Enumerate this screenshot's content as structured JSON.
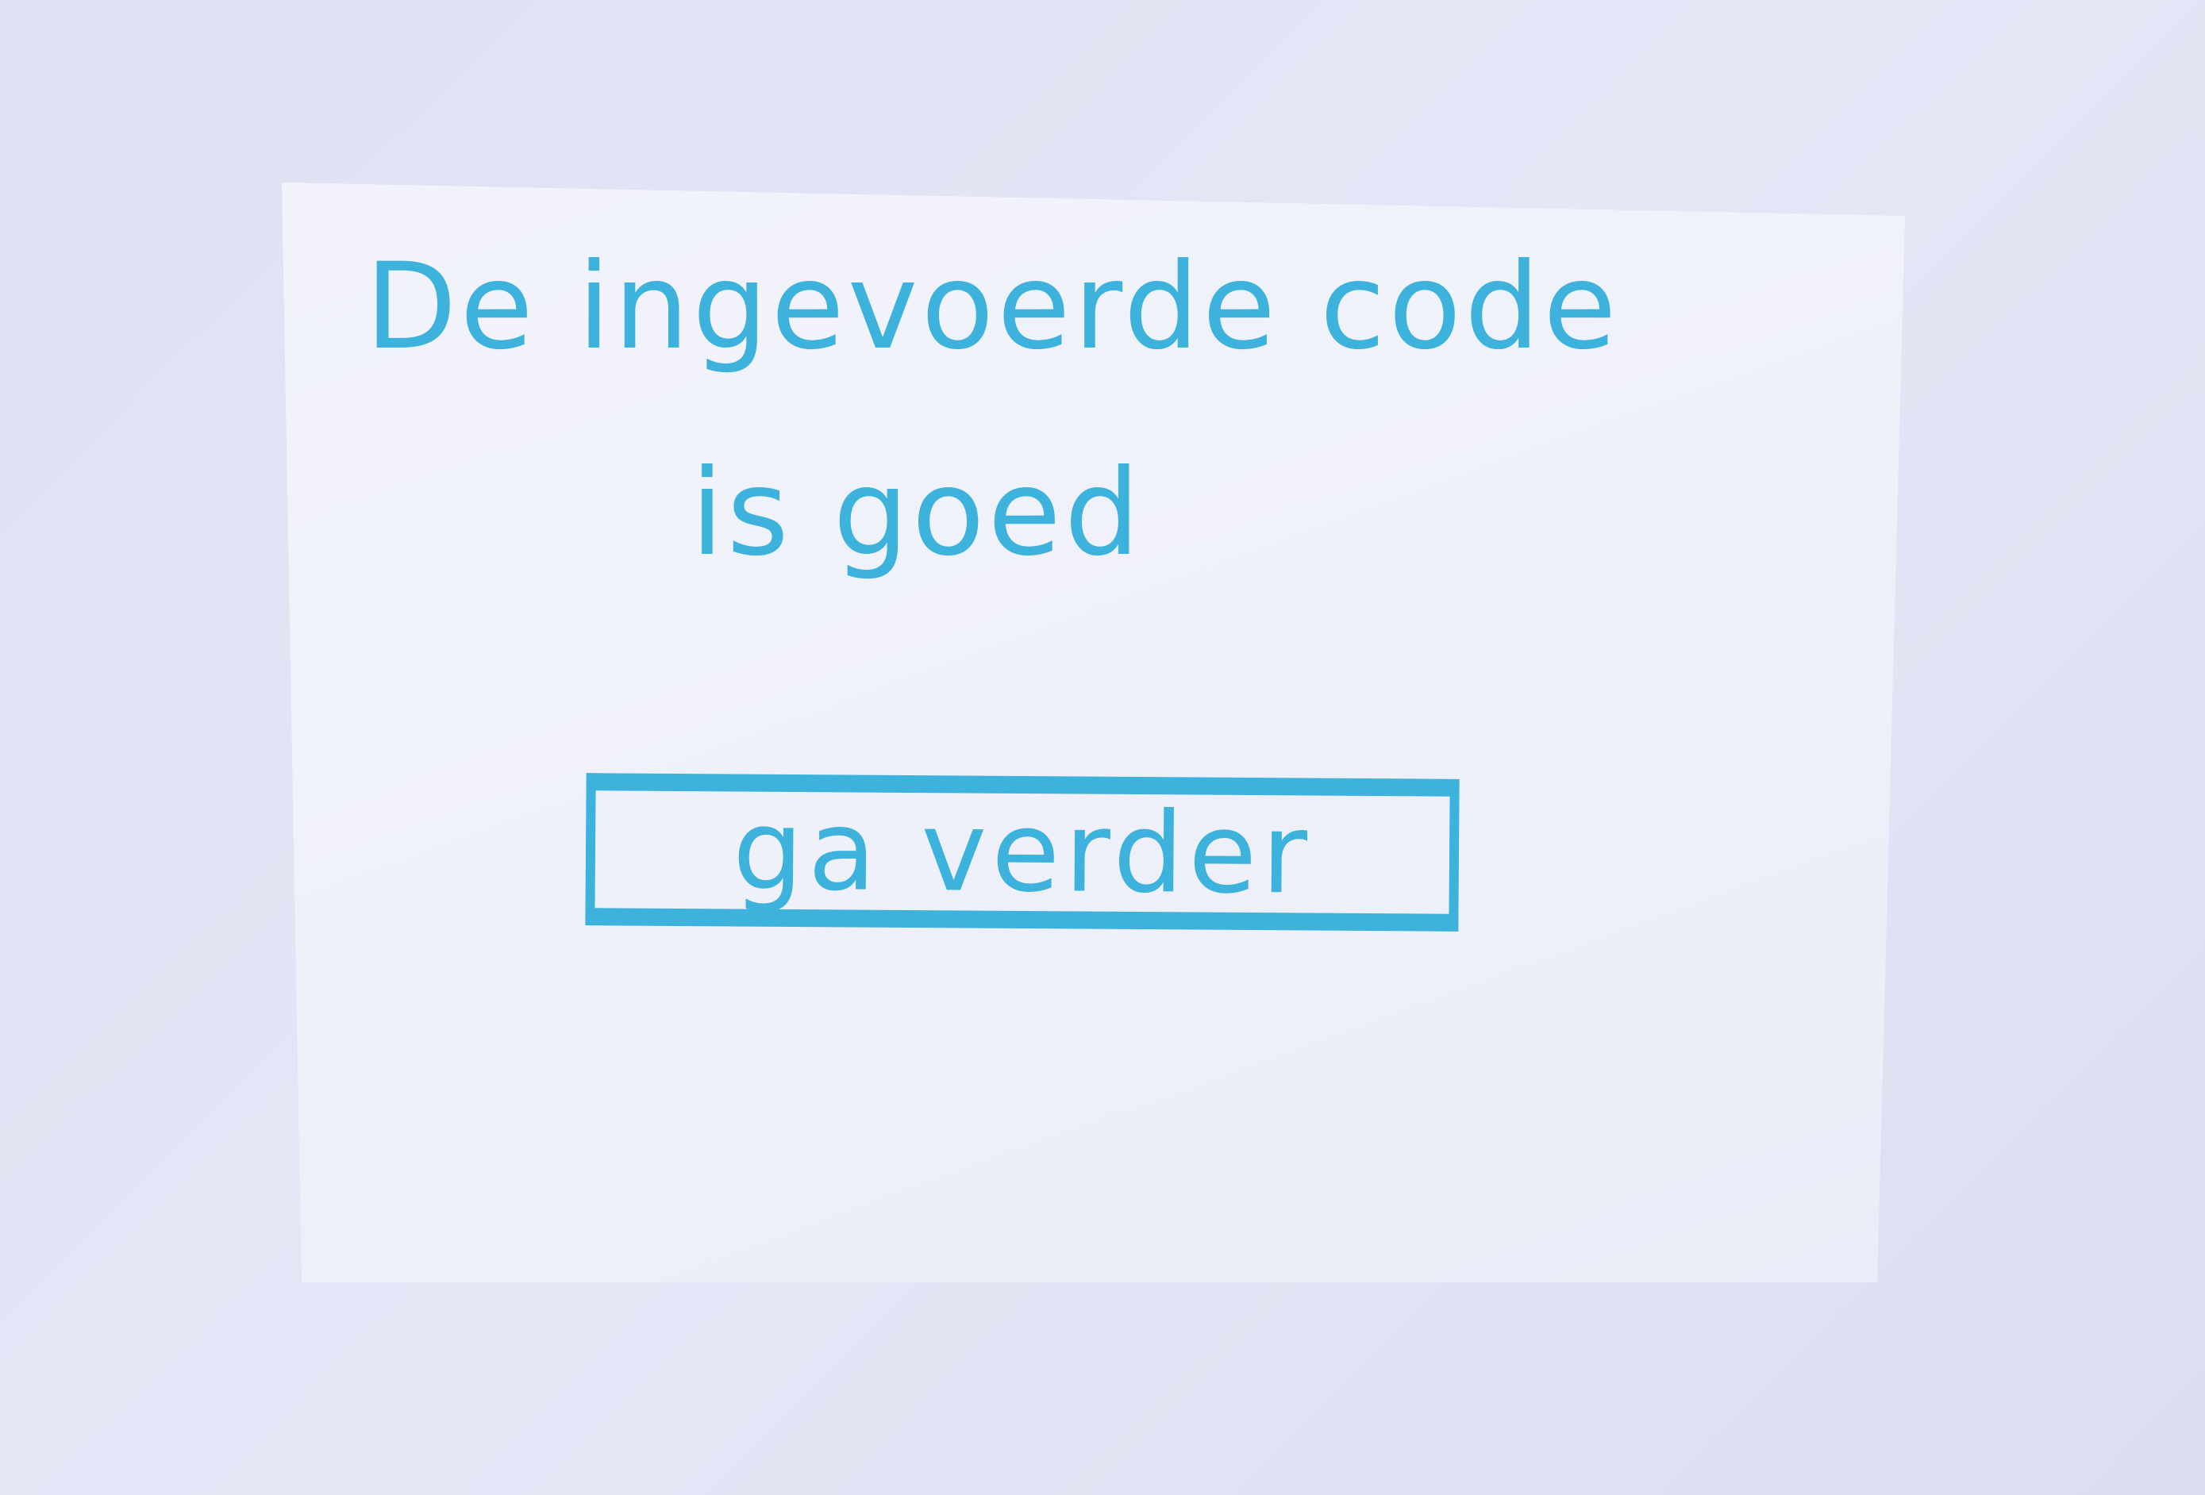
{
  "screen": {
    "message_line1": "De ingevoerde code",
    "message_line2": "is goed",
    "continue_button": "ga verder"
  },
  "colors": {
    "ink": "#3cb2dc",
    "paper": "#f0f2fa",
    "background": "#dde1f2"
  }
}
